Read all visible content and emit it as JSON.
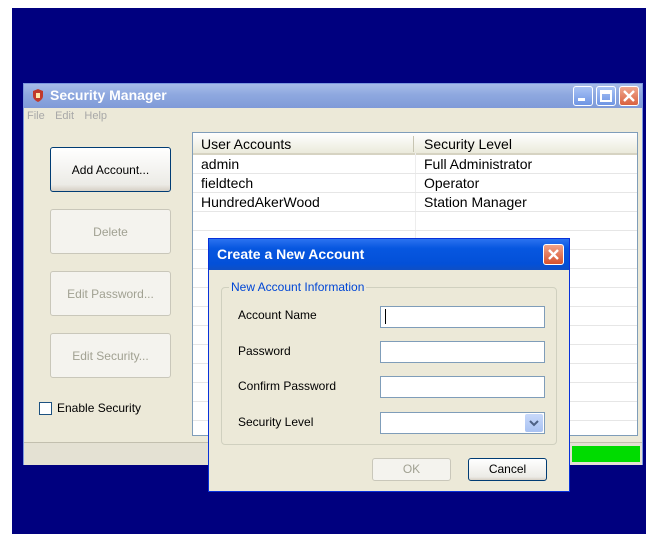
{
  "window": {
    "title": "Security Manager",
    "menu": [
      "File",
      "Edit",
      "Help"
    ]
  },
  "buttons": {
    "add_account": "Add Account...",
    "delete": "Delete",
    "edit_password": "Edit Password...",
    "edit_security": "Edit Security..."
  },
  "enable_security": {
    "label": "Enable Security",
    "checked": false
  },
  "accounts_table": {
    "columns": [
      "User Accounts",
      "Security Level"
    ],
    "rows": [
      {
        "user": "admin",
        "level": "Full Administrator"
      },
      {
        "user": "fieldtech",
        "level": "Operator"
      },
      {
        "user": "HundredAkerWood",
        "level": "Station Manager"
      }
    ]
  },
  "dialog": {
    "title": "Create a New Account",
    "group_label": "New Account Information",
    "fields": {
      "account_name": {
        "label": "Account Name",
        "value": ""
      },
      "password": {
        "label": "Password",
        "value": ""
      },
      "confirm_password": {
        "label": "Confirm Password",
        "value": ""
      },
      "security_level": {
        "label": "Security Level",
        "value": ""
      }
    },
    "ok_label": "OK",
    "cancel_label": "Cancel"
  },
  "colors": {
    "desktop": "#00007f",
    "titlebar_inactive": "#8ea8df",
    "dialog_titlebar": "#0350d8",
    "progress": "#00dc00"
  }
}
